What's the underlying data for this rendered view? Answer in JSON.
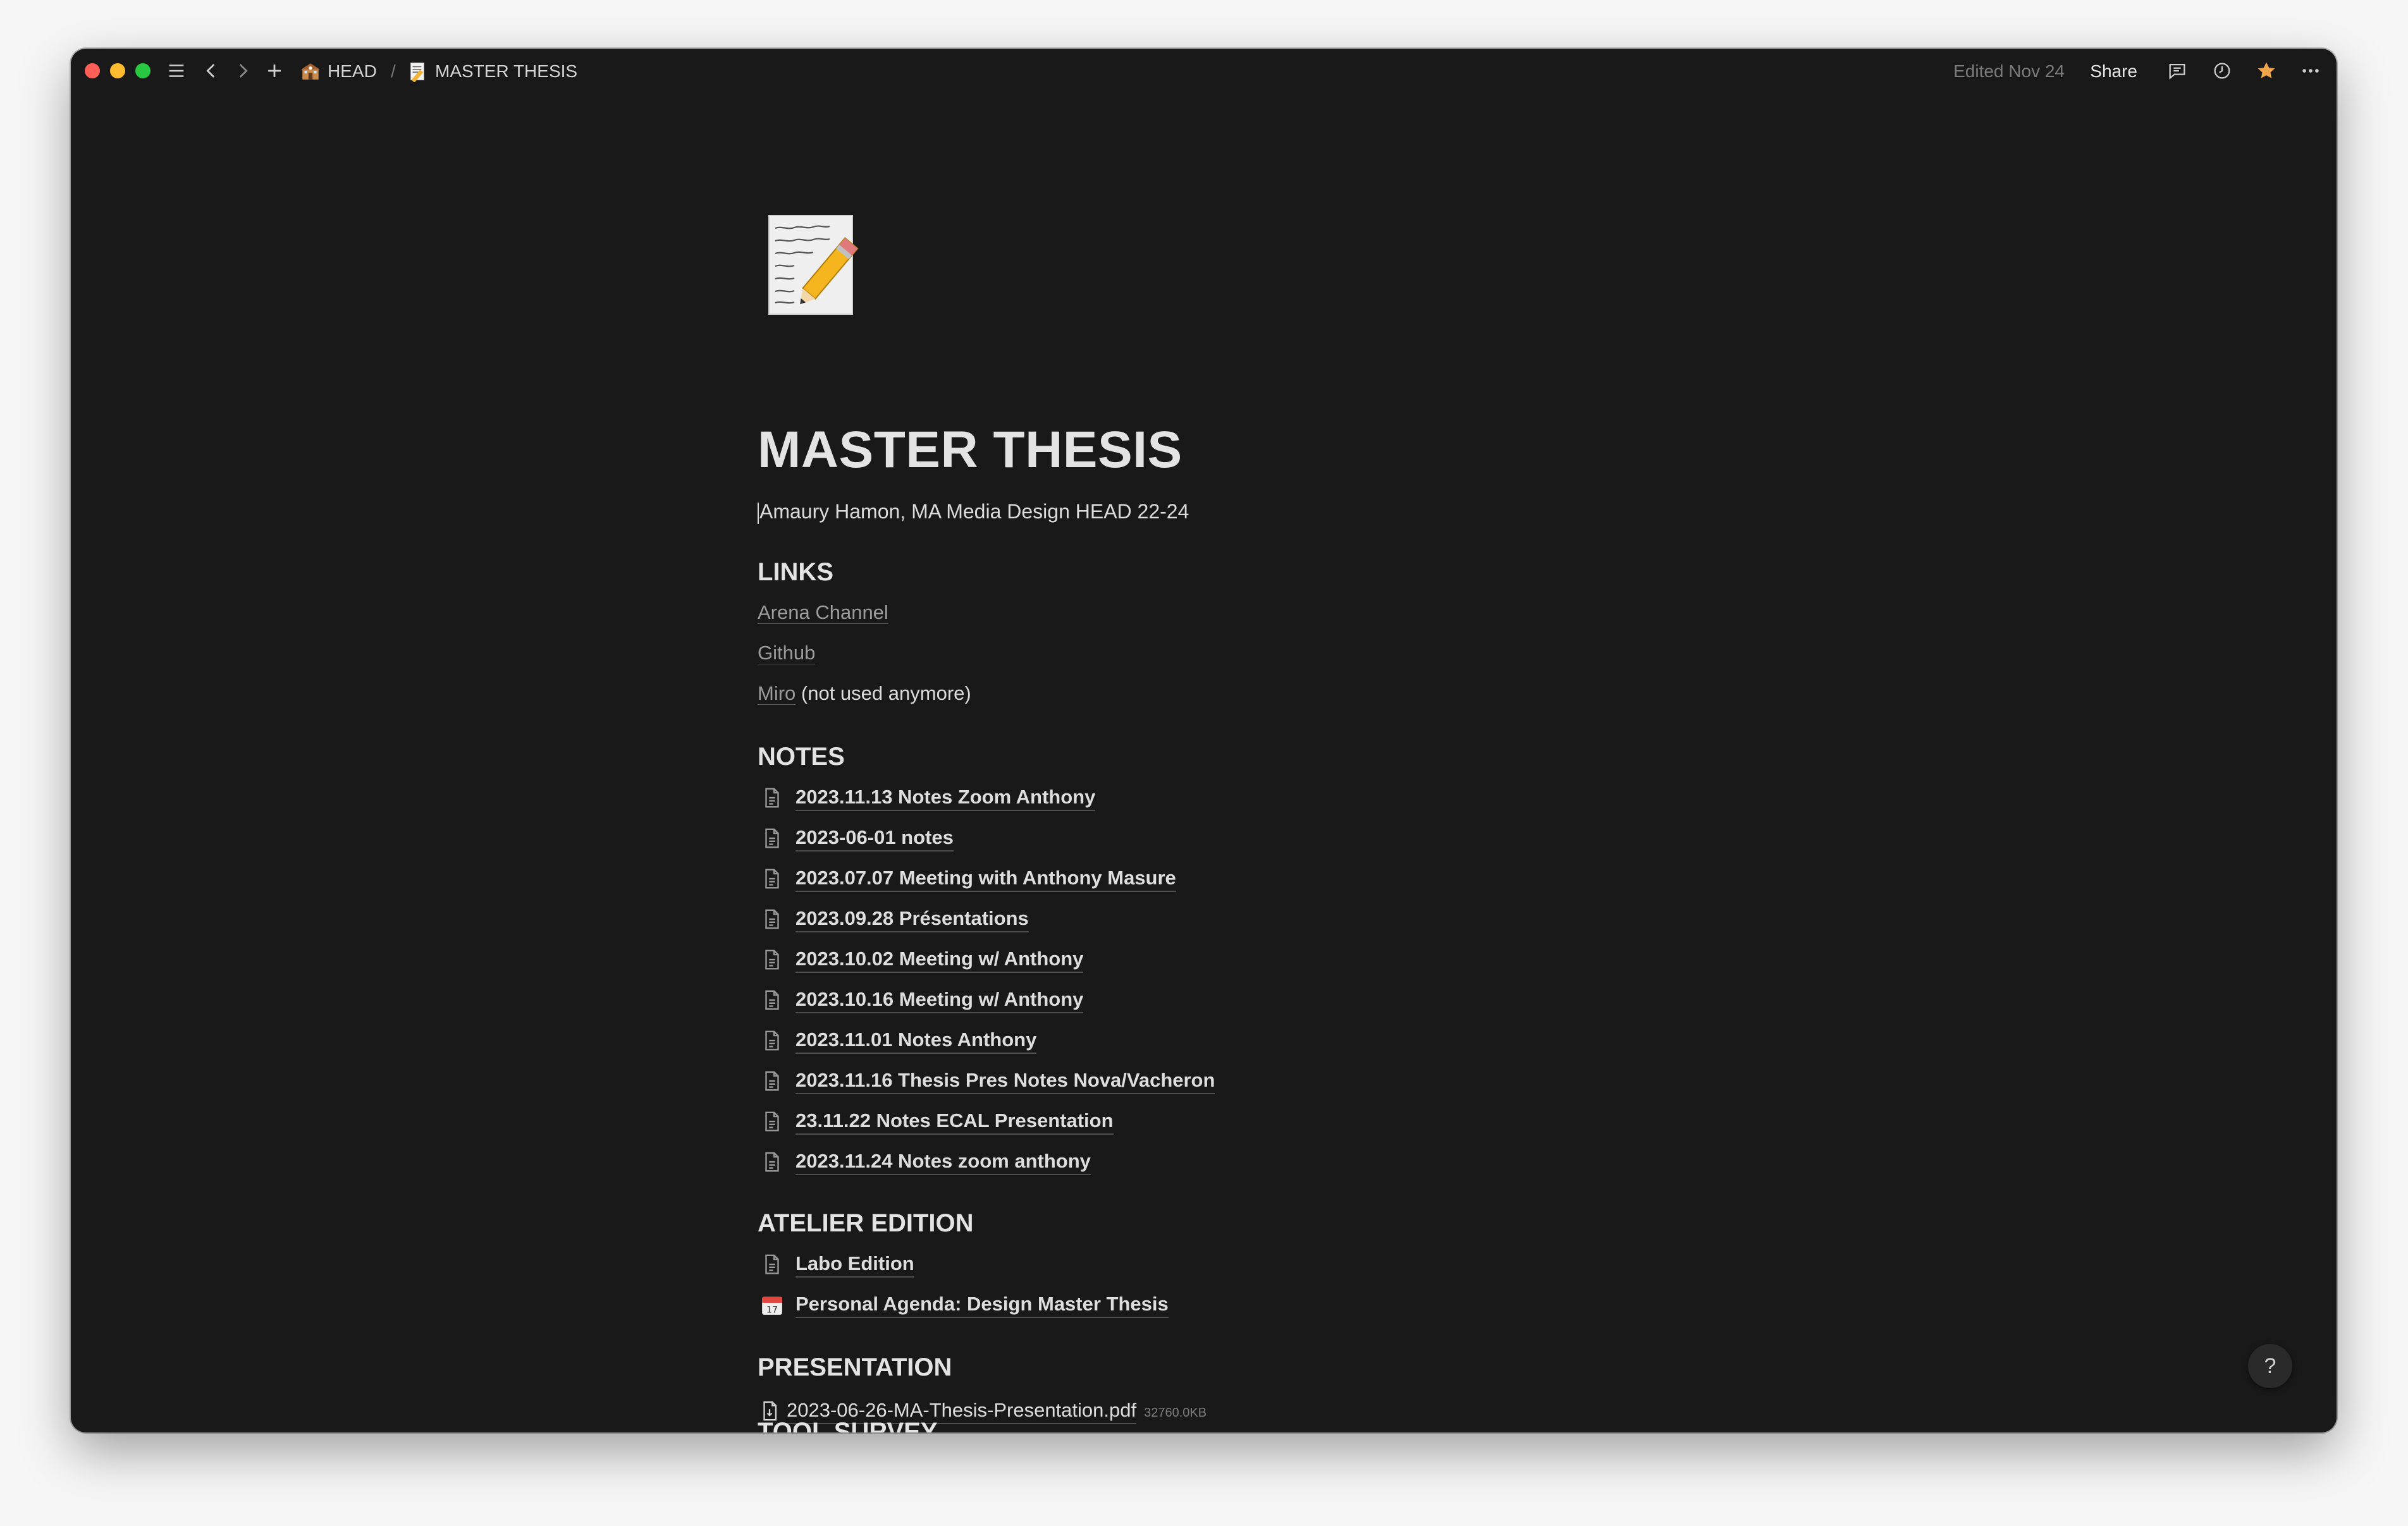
{
  "topbar": {
    "breadcrumb_parent": "HEAD",
    "breadcrumb_current": "MASTER THESIS",
    "edited": "Edited Nov 24",
    "share": "Share"
  },
  "page": {
    "title": "MASTER THESIS",
    "subtitle": "Amaury Hamon, MA Media Design HEAD 22-24"
  },
  "links": {
    "heading": "LINKS",
    "arena": "Arena Channel",
    "github": "Github",
    "miro": "Miro",
    "miro_note": "(not used anymore)"
  },
  "notes": {
    "heading": "NOTES",
    "items": [
      "2023.11.13 Notes Zoom Anthony",
      "2023-06-01 notes",
      "2023.07.07 Meeting with Anthony Masure",
      "2023.09.28 Présentations",
      "2023.10.02 Meeting w/ Anthony",
      "2023.10.16 Meeting w/ Anthony",
      "2023.11.01 Notes Anthony",
      "2023.11.16 Thesis Pres Notes Nova/Vacheron",
      "23.11.22 Notes ECAL Presentation",
      "2023.11.24 Notes zoom anthony"
    ]
  },
  "atelier": {
    "heading": "ATELIER EDITION",
    "labo": "Labo Edition",
    "agenda": "Personal Agenda: Design Master Thesis",
    "calendar_day": "17"
  },
  "presentation": {
    "heading": "PRESENTATION",
    "file_name": "2023-06-26-MA-Thesis-Presentation.pdf",
    "file_size": "32760.0KB"
  },
  "tool_survey": {
    "heading": "TOOL SURVEY"
  },
  "help": "?",
  "colors": {
    "background": "#191919",
    "text": "#e3e3e3",
    "muted": "#9b9b9b",
    "favorite": "#f0a44a"
  }
}
